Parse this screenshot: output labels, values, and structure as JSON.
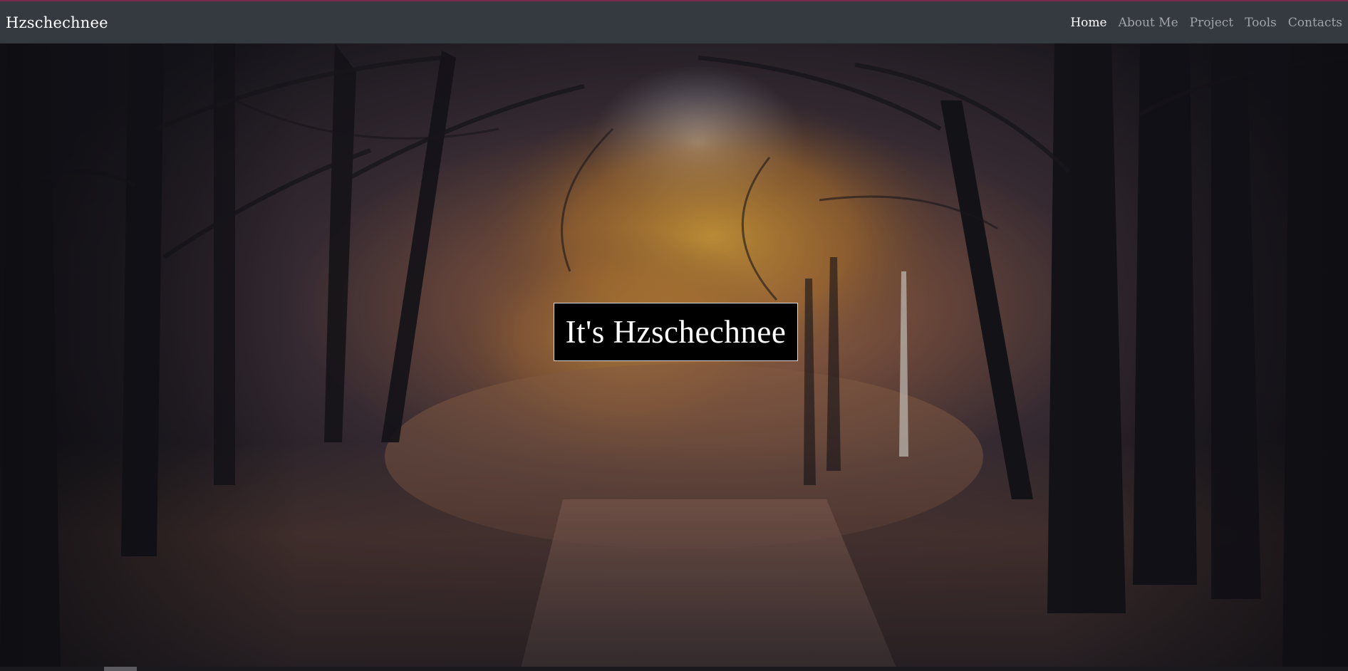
{
  "navbar": {
    "brand": "Hzschechnee",
    "links": [
      {
        "label": "Home",
        "active": true
      },
      {
        "label": "About Me",
        "active": false
      },
      {
        "label": "Project",
        "active": false
      },
      {
        "label": "Tools",
        "active": false
      },
      {
        "label": "Contacts",
        "active": false
      }
    ]
  },
  "hero": {
    "headline": "It's Hzschechnee"
  },
  "colors": {
    "navbar_bg": "#343a40",
    "nav_active": "#ffffff",
    "nav_inactive": "#a0a4a9",
    "accent_line": "#7a2a4a",
    "headline_bg": "#000000",
    "headline_text": "#ffffff"
  }
}
